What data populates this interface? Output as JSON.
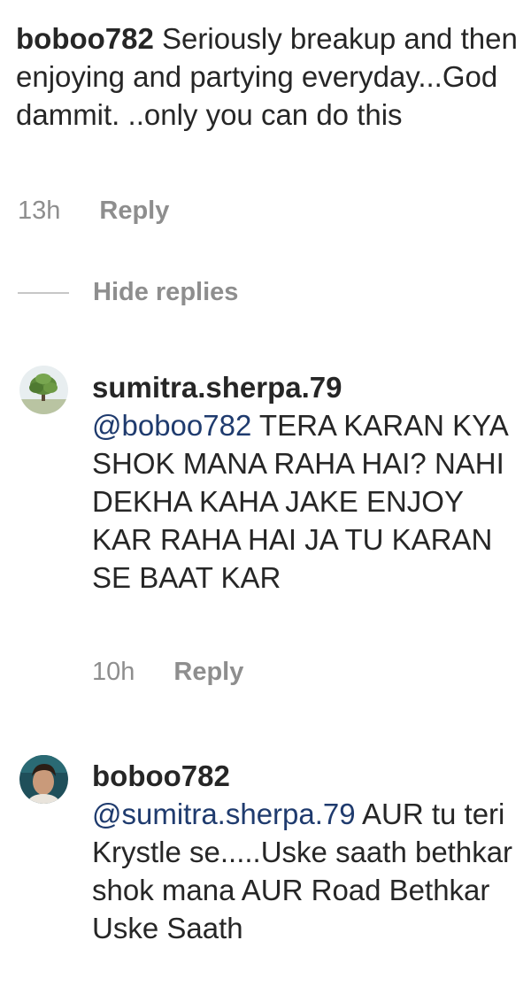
{
  "comment": {
    "username": "boboo782",
    "text": "Seriously breakup and then enjoying and partying everyday...God dammit. ..only you can do this",
    "time": "13h",
    "reply_label": "Reply"
  },
  "thread": {
    "hide_replies_label": "Hide replies"
  },
  "replies": [
    {
      "username": "sumitra.sherpa.79",
      "avatar_icon": "tree-photo-avatar",
      "mention": "@boboo782",
      "text": "TERA KARAN KYA SHOK MANA RAHA HAI? NAHI DEKHA KAHA JAKE ENJOY KAR RAHA HAI  JA TU KARAN SE BAAT KAR",
      "time": "10h",
      "reply_label": "Reply"
    },
    {
      "username": "boboo782",
      "avatar_icon": "man-portrait-avatar",
      "mention": "@sumitra.sherpa.79",
      "text": "AUR tu teri Krystle se.....Uske saath bethkar shok mana AUR Road Bethkar Uske Saath"
    }
  ],
  "colors": {
    "text": "#262626",
    "meta": "#8e8e8e",
    "mention": "#1f3b6e"
  }
}
